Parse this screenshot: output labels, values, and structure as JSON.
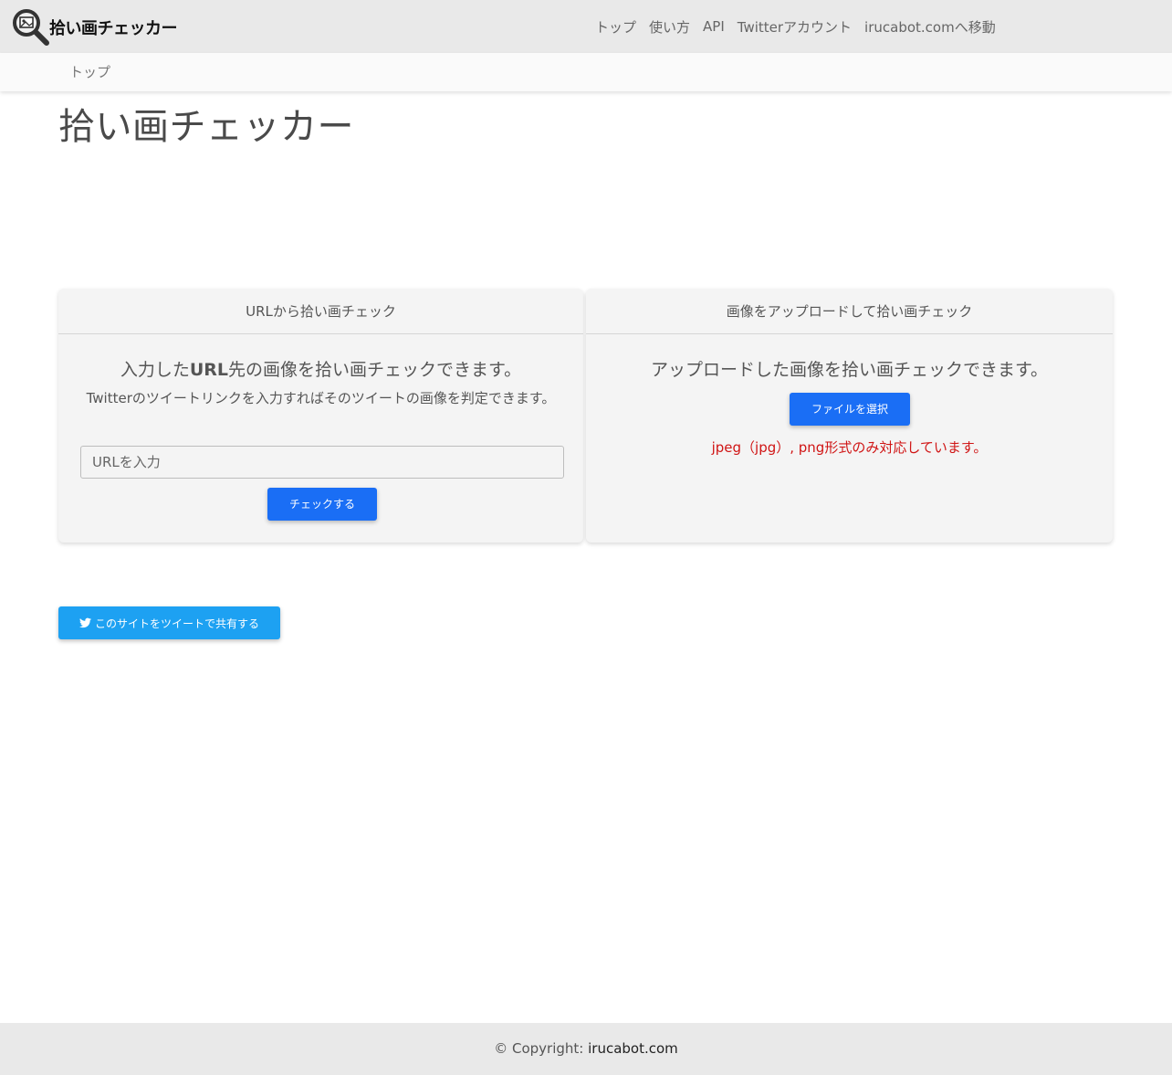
{
  "header": {
    "logo_text": "拾い画チェッカー",
    "nav": [
      {
        "label": "トップ"
      },
      {
        "label": "使い方"
      },
      {
        "label": "API"
      },
      {
        "label": "Twitterアカウント"
      },
      {
        "label": "irucabot.comへ移動"
      }
    ]
  },
  "breadcrumb": {
    "current": "トップ"
  },
  "main": {
    "title": "拾い画チェッカー",
    "url_card": {
      "header": "URLから拾い画チェック",
      "lead_prefix": "入力した",
      "lead_bold": "URL",
      "lead_suffix": "先の画像を拾い画チェックできます。",
      "description": "Twitterのツイートリンクを入力すればそのツイートの画像を判定できます。",
      "input_placeholder": "URLを入力",
      "button_label": "チェックする"
    },
    "upload_card": {
      "header": "画像をアップロードして拾い画チェック",
      "lead": "アップロードした画像を拾い画チェックできます。",
      "button_label": "ファイルを選択",
      "note": "jpeg（jpg）, png形式のみ対応しています。"
    },
    "share_button_label": "このサイトをツイートで共有する"
  },
  "footer": {
    "copyright_prefix": "© Copyright: ",
    "copyright_link": "irucabot.com"
  },
  "colors": {
    "primary": "#1a6ef5",
    "twitter": "#1da1f2",
    "note": "#d01515",
    "navbar_bg": "#e9e9e9"
  }
}
